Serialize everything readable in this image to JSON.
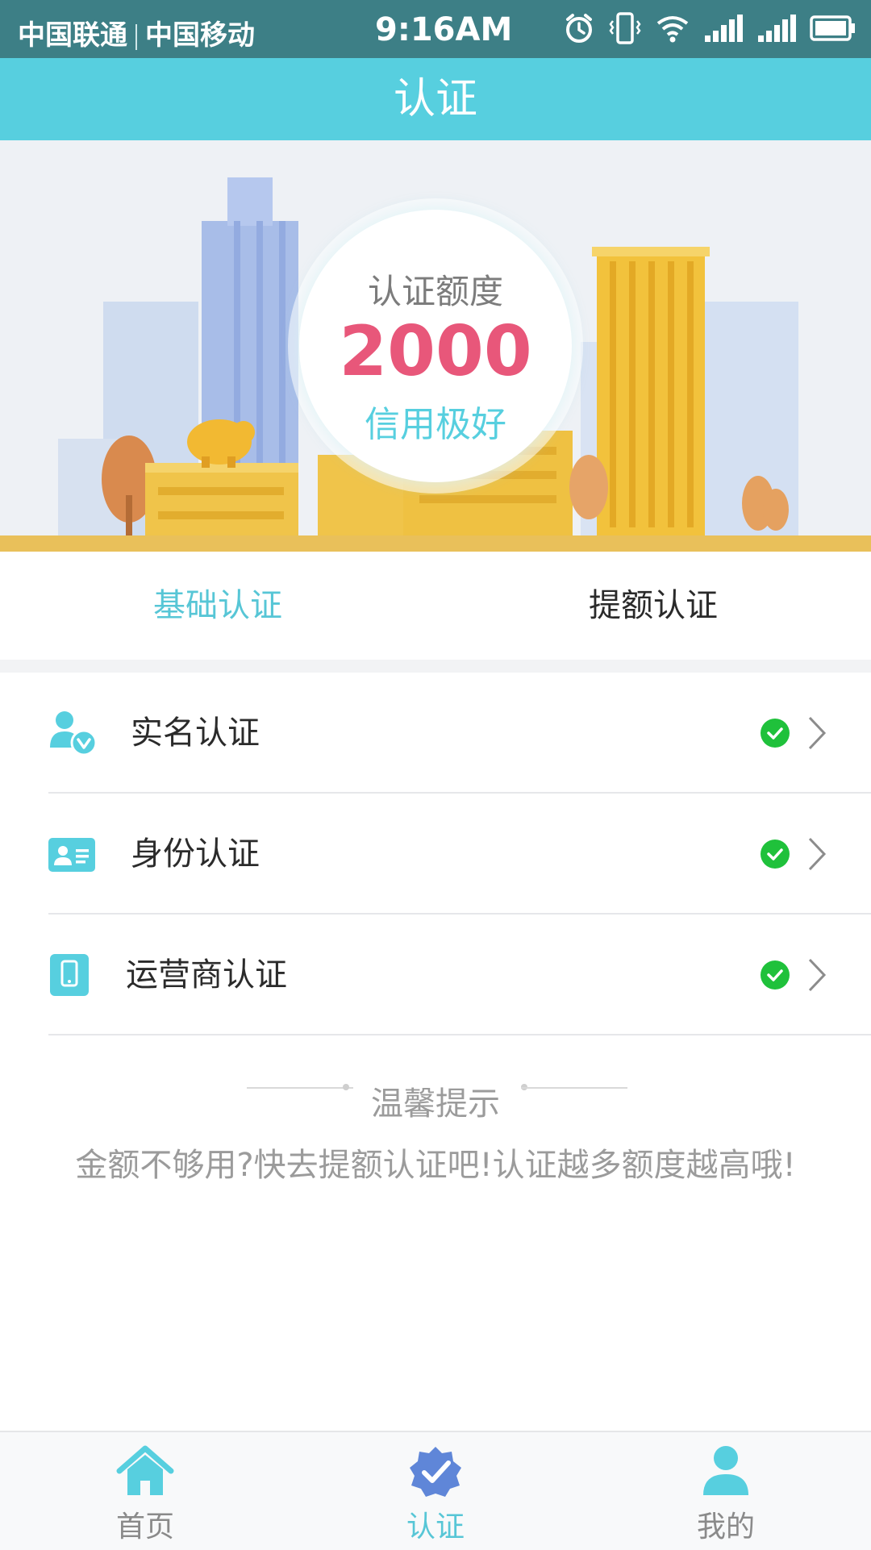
{
  "status_bar": {
    "carrier1": "中国联通",
    "carrier2": "中国移动",
    "time": "9:16AM",
    "icons": [
      "alarm-icon",
      "vibrate-icon",
      "wifi-icon",
      "signal-icon",
      "signal-icon",
      "battery-icon"
    ]
  },
  "header": {
    "title": "认证"
  },
  "banner": {
    "label": "认证额度",
    "amount": "2000",
    "status": "信用极好"
  },
  "tabs": [
    {
      "label": "基础认证",
      "active": true
    },
    {
      "label": "提额认证",
      "active": false
    }
  ],
  "verification_items": [
    {
      "label": "实名认证",
      "icon": "user-verified-icon",
      "verified": true
    },
    {
      "label": "身份认证",
      "icon": "id-card-icon",
      "verified": true
    },
    {
      "label": "运营商认证",
      "icon": "phone-icon",
      "verified": true
    }
  ],
  "tip": {
    "title": "温馨提示",
    "text": "金额不够用?快去提额认证吧!认证越多额度越高哦!"
  },
  "bottom_nav": [
    {
      "label": "首页",
      "icon": "home-icon",
      "active": false
    },
    {
      "label": "认证",
      "icon": "verified-badge-icon",
      "active": true
    },
    {
      "label": "我的",
      "icon": "user-icon",
      "active": false
    }
  ],
  "colors": {
    "status_bar": "#3d7f86",
    "accent": "#57cfdf",
    "amount": "#e8577a",
    "check": "#1fc13b"
  }
}
